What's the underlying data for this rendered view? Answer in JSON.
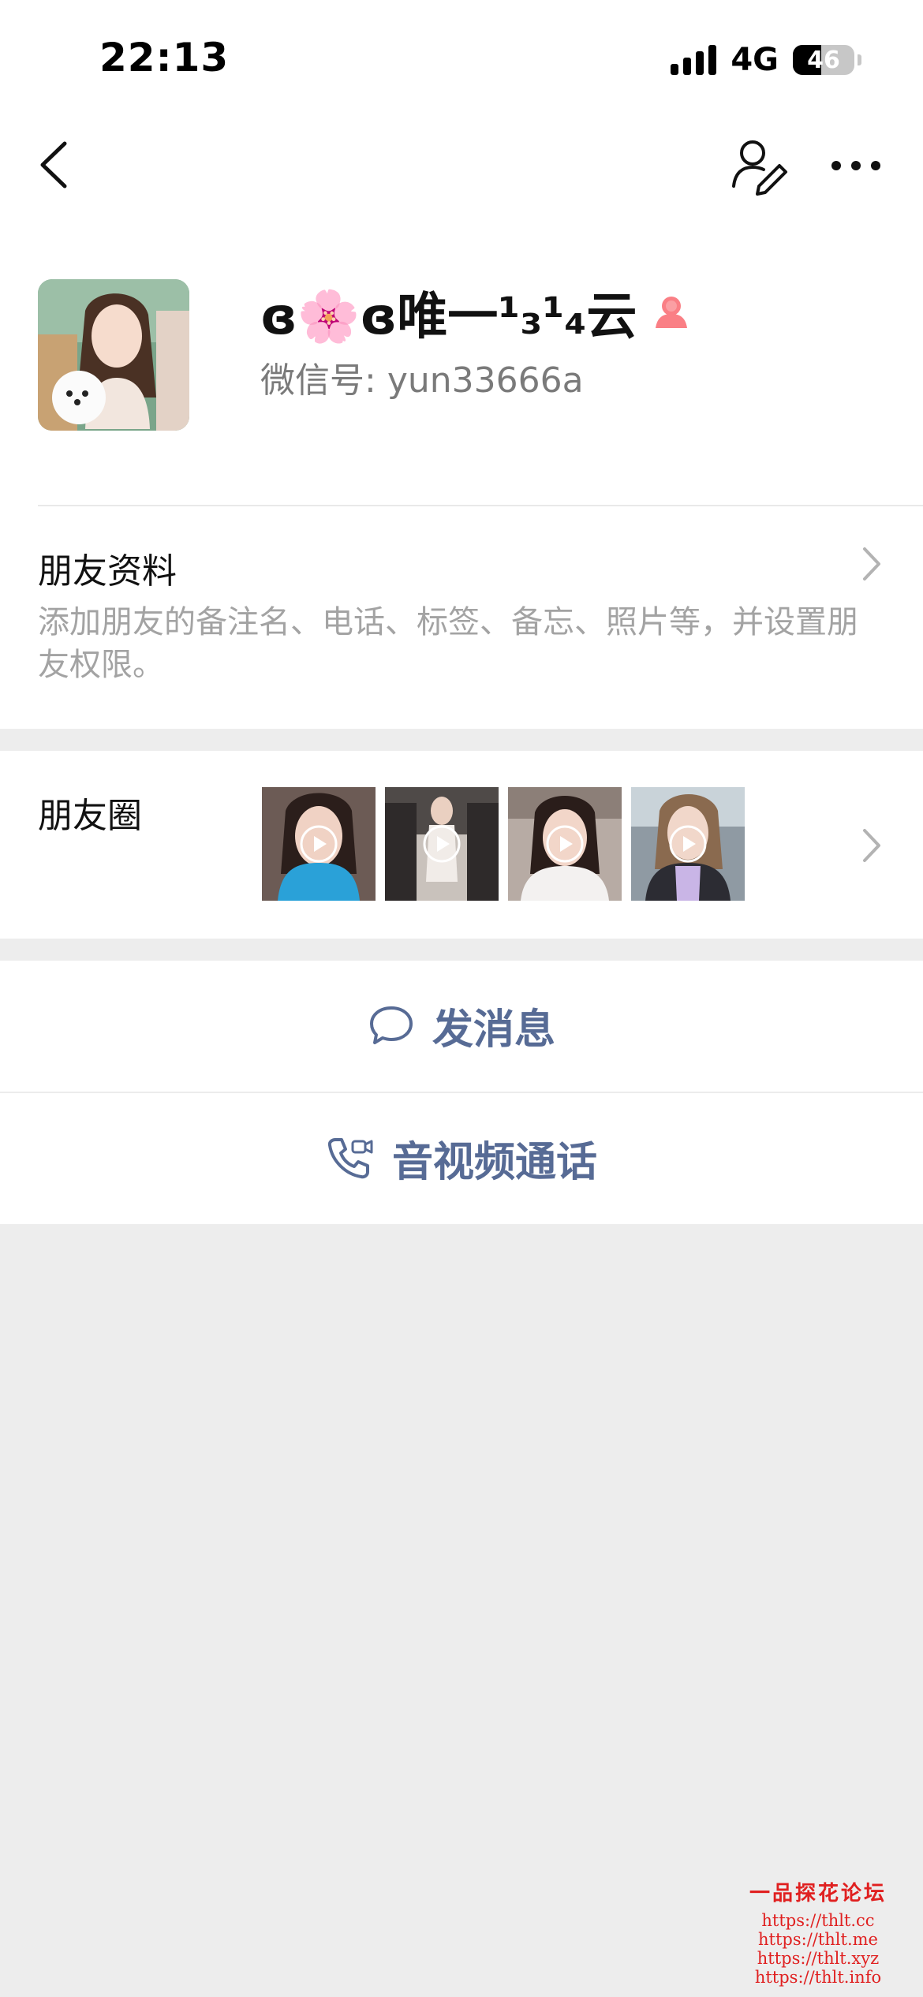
{
  "status_bar": {
    "time": "22:13",
    "network": "4G",
    "battery": "46",
    "battery_level": 0.46
  },
  "nav": {
    "back_icon": "chevron-left-icon",
    "edit_icon": "edit-contact-icon",
    "more_icon": "more-dots-icon"
  },
  "profile": {
    "nickname": "ɞ🌸ɞ唯一¹₃¹₄云",
    "gender_icon": "female-icon",
    "gender_color": "#fa7f85",
    "wechat_id_label": "微信号: ",
    "wechat_id": "yun33666a"
  },
  "friend_info": {
    "title": "朋友资料",
    "description": "添加朋友的备注名、电话、标签、备忘、照片等，并设置朋友权限。"
  },
  "moments": {
    "label": "朋友圈",
    "thumbnail_count": 4
  },
  "actions": {
    "message_label": "发消息",
    "call_label": "音视频通话",
    "accent_color": "#576b95"
  },
  "watermark": {
    "title": "一品探花论坛",
    "links": [
      "https://thlt.cc",
      "https://thlt.me",
      "https://thlt.xyz",
      "https://thlt.info"
    ]
  }
}
